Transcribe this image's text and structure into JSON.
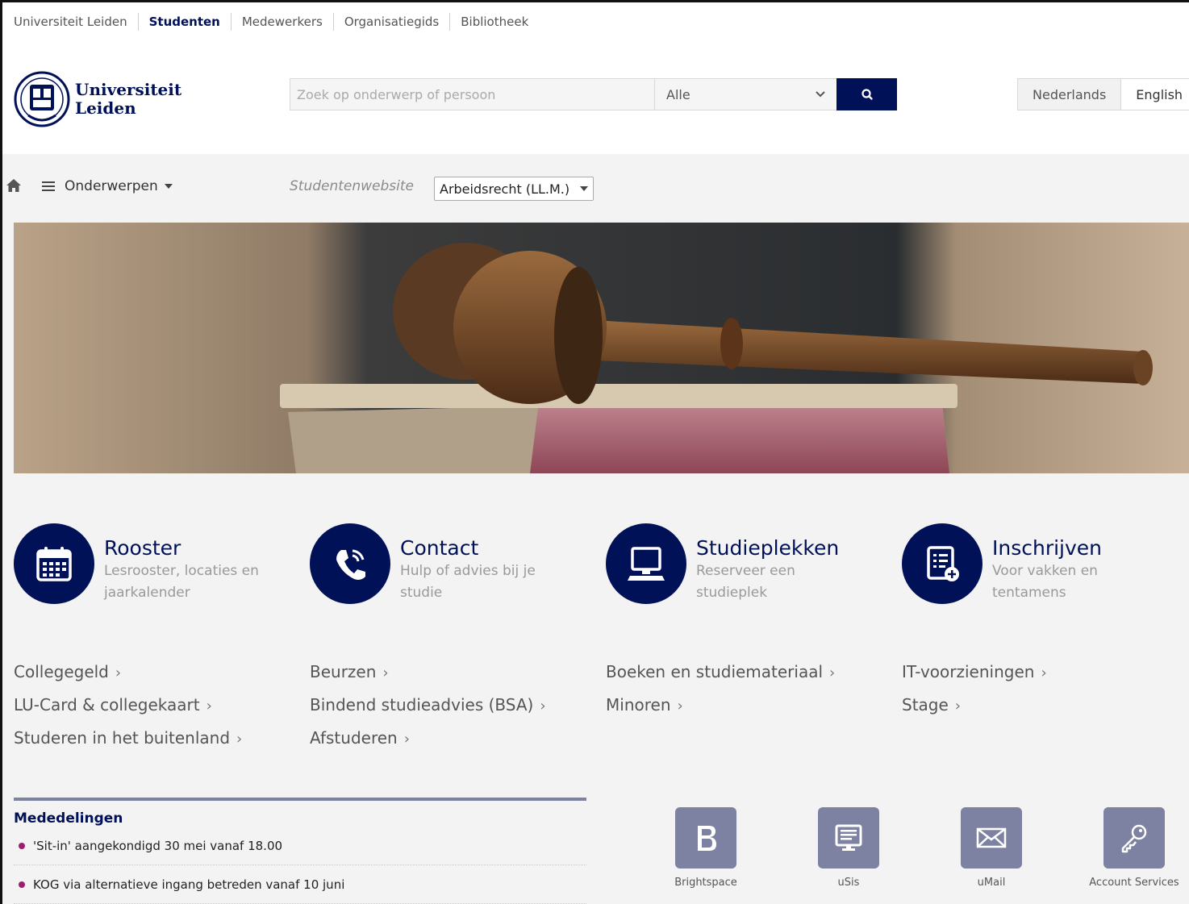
{
  "topnav": {
    "items": [
      "Universiteit Leiden",
      "Studenten",
      "Medewerkers",
      "Organisatiegids",
      "Bibliotheek"
    ],
    "active_index": 1
  },
  "logo": {
    "line1": "Universiteit",
    "line2": "Leiden"
  },
  "search": {
    "placeholder": "Zoek op onderwerp of persoon",
    "scope": "Alle"
  },
  "languages": {
    "current": "Nederlands",
    "other": "English"
  },
  "subnav": {
    "menu_label": "Onderwerpen",
    "site_label": "Studentenwebsite",
    "programme": "Arbeidsrecht (LL.M.)"
  },
  "quicklinks": [
    {
      "title": "Rooster",
      "sub": "Lesrooster, locaties en jaarkalender",
      "icon": "calendar-icon"
    },
    {
      "title": "Contact",
      "sub": "Hulp of advies bij je studie",
      "icon": "phone-icon"
    },
    {
      "title": "Studieplekken",
      "sub": "Reserveer een studieplek",
      "icon": "computer-icon"
    },
    {
      "title": "Inschrijven",
      "sub": "Voor vakken en tentamens",
      "icon": "form-add-icon"
    }
  ],
  "links": {
    "col1": [
      "Collegegeld",
      "LU-Card & collegekaart",
      "Studeren in het buitenland"
    ],
    "col2": [
      "Beurzen",
      "Bindend studieadvies (BSA)",
      "Afstuderen"
    ],
    "col3": [
      "Boeken en studiemateriaal",
      "Minoren"
    ],
    "col4": [
      "IT-voorzieningen",
      "Stage"
    ],
    "chevron": "›"
  },
  "news": {
    "heading": "Mededelingen",
    "items": [
      "'Sit-in' aangekondigd 30 mei vanaf 18.00",
      "KOG via alternatieve ingang betreden vanaf 10 juni"
    ]
  },
  "tiles": [
    {
      "label": "Brightspace",
      "icon": "brightspace-icon"
    },
    {
      "label": "uSis",
      "icon": "screen-icon"
    },
    {
      "label": "uMail",
      "icon": "envelope-icon"
    },
    {
      "label": "Account Services",
      "icon": "key-icon"
    }
  ],
  "colors": {
    "brand": "#001158",
    "accent": "#a01d6e",
    "tile": "#7d82a3"
  }
}
